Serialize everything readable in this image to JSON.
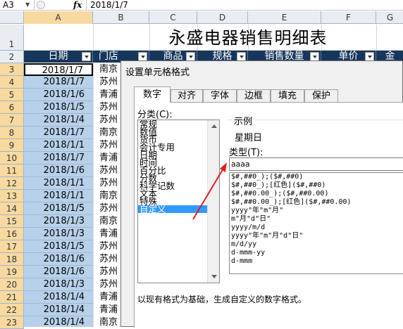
{
  "formula_bar": {
    "name_box": "A3",
    "fx": "fx",
    "value": "2018/1/7"
  },
  "columns": [
    "A",
    "B",
    "C",
    "D",
    "E",
    "F",
    "G"
  ],
  "rows": [
    "1",
    "2",
    "3",
    "4",
    "5",
    "6",
    "7",
    "8",
    "9",
    "10",
    "11",
    "12",
    "13",
    "14",
    "15",
    "16",
    "17",
    "18",
    "19",
    "20",
    "21",
    "22",
    "23"
  ],
  "sheet": {
    "title": "永盛电器销售明细表",
    "headers": [
      "日期",
      "门店",
      "商品",
      "规格",
      "销售数量",
      "单价",
      "金"
    ],
    "dates": [
      "2018/1/7",
      "2018/1/7",
      "2018/1/6",
      "2018/1/5",
      "2018/1/4",
      "2018/1/7",
      "2018/1/1",
      "2018/1/7",
      "2018/1/6",
      "2018/1/1",
      "2018/1/1",
      "2018/1/5",
      "2018/1/3",
      "2018/1/3",
      "2018/1/5",
      "2018/1/6",
      "2018/1/6",
      "2018/1/3",
      "2018/1/4",
      "2018/1/4",
      "2018/1/4"
    ],
    "stores": [
      "南京",
      "苏州",
      "青浦",
      "苏州",
      "苏州",
      "南京",
      "苏州",
      "青浦",
      "苏州",
      "苏州",
      "南京",
      "苏州",
      "南京",
      "青浦",
      "苏州",
      "苏州",
      "苏州",
      "苏州",
      "青浦",
      "青浦",
      "南京"
    ]
  },
  "dialog": {
    "title": "设置单元格格式",
    "tabs": [
      "数字",
      "对齐",
      "字体",
      "边框",
      "填充",
      "保护"
    ],
    "active_tab": "数字",
    "category_label": "分类(C):",
    "categories": [
      "常规",
      "数值",
      "货币",
      "会计专用",
      "日期",
      "时间",
      "百分比",
      "分数",
      "科学记数",
      "文本",
      "特殊",
      "自定义"
    ],
    "selected_category": "自定义",
    "sample_label": "示例",
    "sample_value": "星期日",
    "type_label": "类型(T):",
    "type_value": "aaaa",
    "formats": [
      "$#,##0_);($#,##0)",
      "$#,##0_);[红色]($#,##0)",
      "$#,##0.00_);($#,##0.00)",
      "$#,##0.00_);[红色]($#,##0.00)",
      "yyyy\"年\"m\"月\"",
      "m\"月\"d\"日\"",
      "yyyy/m/d",
      "yyyy\"年\"m\"月\"d\"日\"",
      "m/d/yy",
      "d-mmm-yy",
      "d-mmm"
    ],
    "description": "以现有格式为基础，生成自定义的数字格式。"
  },
  "colors": {
    "header_fill": "#16365c",
    "selected_fill": "#b8d1ea",
    "annotation_arrow": "#e02020",
    "list_highlight": "#3399ff"
  }
}
